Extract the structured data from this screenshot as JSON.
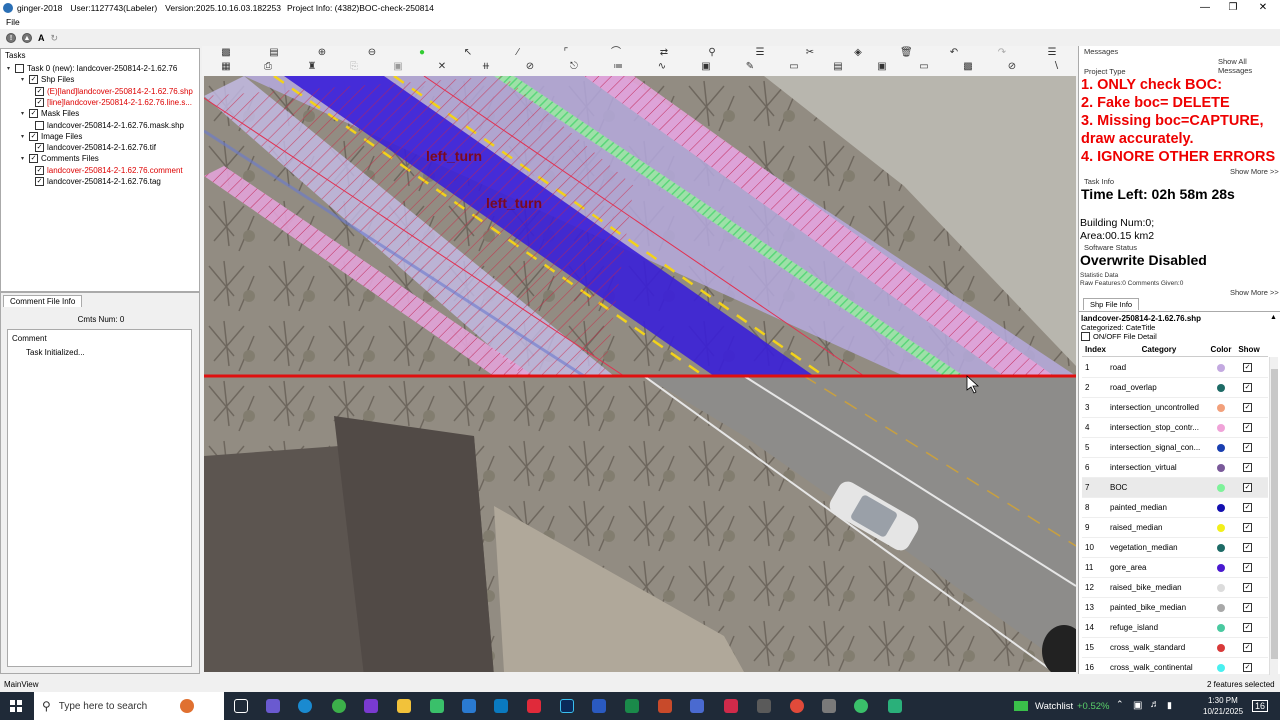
{
  "window": {
    "title": "ginger-2018",
    "user": "User:1127743(Labeler)",
    "version": "Version:2025.10.16.03.182253",
    "project": "Project Info: (4382)BOC-check-250814"
  },
  "menu": {
    "file": "File"
  },
  "left_toolbar": {
    "a_label": "A"
  },
  "tasks": {
    "title": "Tasks",
    "items": [
      {
        "label": "Task 0 (new): landcover-250814-2-1.62.76",
        "checked": false,
        "red": false
      },
      {
        "label": "Shp Files",
        "checked": true,
        "red": false
      },
      {
        "label": "(E)[land]landcover-250814-2-1.62.76.shp",
        "checked": true,
        "red": true
      },
      {
        "label": "[line]landcover-250814-2-1.62.76.line.s...",
        "checked": true,
        "red": true
      },
      {
        "label": "Mask Files",
        "checked": true,
        "red": false
      },
      {
        "label": "landcover-250814-2-1.62.76.mask.shp",
        "checked": false,
        "red": false
      },
      {
        "label": "Image Files",
        "checked": true,
        "red": false
      },
      {
        "label": "landcover-250814-2-1.62.76.tif",
        "checked": true,
        "red": false
      },
      {
        "label": "Comments Files",
        "checked": true,
        "red": false
      },
      {
        "label": "landcover-250814-2-1.62.76.comment",
        "checked": true,
        "red": true
      },
      {
        "label": "landcover-250814-2-1.62.76.tag",
        "checked": true,
        "red": false
      }
    ]
  },
  "comment_panel": {
    "tab": "Comment File Info",
    "count": "Cmts Num:  0",
    "header": "Comment",
    "entry": "Task Initialized..."
  },
  "map": {
    "labels": [
      "left_turn",
      "left_turn"
    ]
  },
  "right": {
    "messages": "Messages",
    "show_all": "Show All Messages",
    "project_type": "Project Type",
    "rules": [
      "1. ONLY check BOC:",
      "2. Fake boc= DELETE",
      "3. Missing boc=CAPTURE,",
      "draw accurately.",
      "4. IGNORE OTHER ERRORS"
    ],
    "show_more": "Show More >>",
    "task_info": "Task Info",
    "time_left": "Time Left: 02h 58m 28s",
    "building": "Building Num:0;",
    "area": "Area:00.15 km2",
    "software_status": "Software Status",
    "overwrite": "Overwrite Disabled",
    "statistic": "Statistic Data",
    "raw": "Raw Features:0 Comments Given:0",
    "shp_tab": "Shp File Info",
    "shp_name": "landcover-250814-2-1.62.76.shp",
    "categorized": "Categorized: CateTitle",
    "onoff": "ON/OFF File Detail",
    "headers": {
      "index": "Index",
      "category": "Category",
      "color": "Color",
      "show": "Show"
    },
    "categories": [
      {
        "index": "1",
        "name": "road",
        "color": "#c3a9e0"
      },
      {
        "index": "2",
        "name": "road_overlap",
        "color": "#1e6b66"
      },
      {
        "index": "3",
        "name": "intersection_uncontrolled",
        "color": "#f2a07b"
      },
      {
        "index": "4",
        "name": "intersection_stop_contr...",
        "color": "#f0a3d8"
      },
      {
        "index": "5",
        "name": "intersection_signal_con...",
        "color": "#1a3fb0"
      },
      {
        "index": "6",
        "name": "intersection_virtual",
        "color": "#7a5a9a"
      },
      {
        "index": "7",
        "name": "BOC",
        "color": "#7ef29a"
      },
      {
        "index": "8",
        "name": "painted_median",
        "color": "#1410b0"
      },
      {
        "index": "9",
        "name": "raised_median",
        "color": "#f2ef1a"
      },
      {
        "index": "10",
        "name": "vegetation_median",
        "color": "#1e6b66"
      },
      {
        "index": "11",
        "name": "gore_area",
        "color": "#4a1ad0"
      },
      {
        "index": "12",
        "name": "raised_bike_median",
        "color": "#dcdcdc"
      },
      {
        "index": "13",
        "name": "painted_bike_median",
        "color": "#a8a8a8"
      },
      {
        "index": "14",
        "name": "refuge_island",
        "color": "#4ac9a0"
      },
      {
        "index": "15",
        "name": "cross_walk_standard",
        "color": "#d83a3a"
      },
      {
        "index": "16",
        "name": "cross_walk_continental",
        "color": "#4af0f0"
      }
    ]
  },
  "status": {
    "left": "MainView",
    "right": "2 features selected"
  },
  "taskbar": {
    "search": "Type here to search",
    "watchlist": "Watchlist",
    "change": "+0.52%",
    "time": "1:30 PM",
    "date": "10/21/2025",
    "notif": "16"
  }
}
